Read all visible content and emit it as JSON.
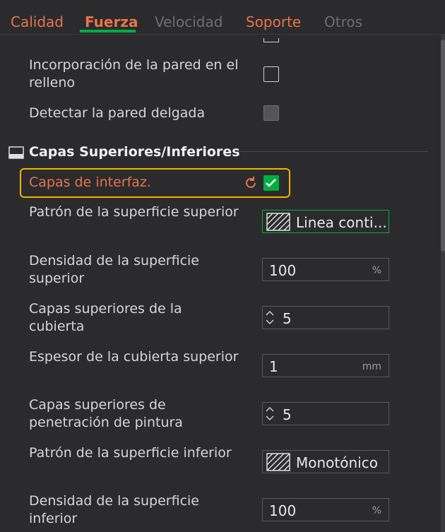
{
  "tabs": [
    {
      "label": "Calidad",
      "color": "#e8734a"
    },
    {
      "label": "Fuerza",
      "color": "#e8734a"
    },
    {
      "label": "Velocidad",
      "color": "#6e6e70"
    },
    {
      "label": "Soporte",
      "color": "#e8734a"
    },
    {
      "label": "Otros",
      "color": "#6e6e70"
    }
  ],
  "settings": {
    "wall_infill_label": "Incorporación de la pared en el relleno",
    "thin_wall_label": "Detectar la pared delgada",
    "section_title": "Capas Superiores/Inferiores",
    "interface_layers_label": "Capas de interfaz.",
    "top_pattern_label": "Patrón de la superficie superior",
    "top_pattern_value": "Linea conti...",
    "top_density_label": "Densidad de la superficie superior",
    "top_density_value": "100",
    "top_density_unit": "%",
    "top_shell_layers_label": "Capas superiores de la cubierta",
    "top_shell_layers_value": "5",
    "top_shell_thickness_label": "Espesor de la cubierta superior",
    "top_shell_thickness_value": "1",
    "top_shell_thickness_unit": "mm",
    "paint_layers_label": "Capas superiores de penetración de pintura",
    "paint_layers_value": "5",
    "bottom_pattern_label": "Patrón de la superficie inferior",
    "bottom_pattern_value": "Monotónico",
    "bottom_density_label": "Densidad de la superficie inferior",
    "bottom_density_value": "100",
    "bottom_density_unit": "%"
  },
  "colors": {
    "accent": "#00ae42",
    "modified": "#e8734a",
    "highlight": "#f0b400"
  },
  "icons": {
    "reset": "reset-icon",
    "pattern": "hatch-pattern-icon",
    "spinner": "spinner-icon",
    "section": "section-icon"
  }
}
